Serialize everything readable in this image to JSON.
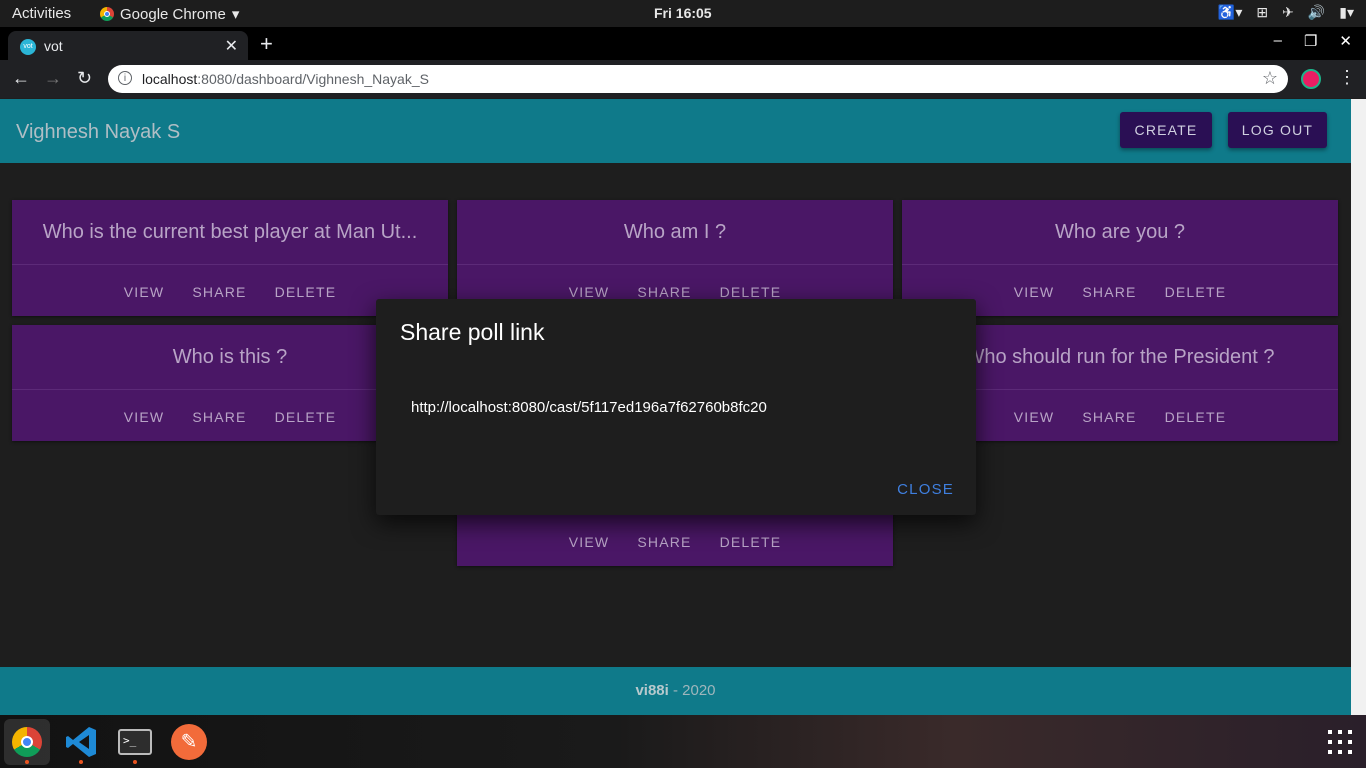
{
  "system_bar": {
    "activities": "Activities",
    "app_name": "Google Chrome",
    "clock": "Fri 16:05"
  },
  "browser": {
    "tab_title": "vot",
    "tab_favicon_text": "vot",
    "url_host": "localhost",
    "url_rest": ":8080/dashboard/Vighnesh_Nayak_S"
  },
  "header": {
    "user_name": "Vighnesh Nayak S",
    "create_label": "CREATE",
    "logout_label": "LOG OUT"
  },
  "polls": [
    {
      "question": "Who is the current best player at Man Ut...",
      "view": "VIEW",
      "share": "SHARE",
      "delete": "DELETE"
    },
    {
      "question": "Who am I ?",
      "view": "VIEW",
      "share": "SHARE",
      "delete": "DELETE"
    },
    {
      "question": "Who are you ?",
      "view": "VIEW",
      "share": "SHARE",
      "delete": "DELETE"
    },
    {
      "question": "Who is this ?",
      "view": "VIEW",
      "share": "SHARE",
      "delete": "DELETE"
    },
    {
      "question": "Who should run for the President ?",
      "view": "VIEW",
      "share": "SHARE",
      "delete": "DELETE"
    },
    {
      "question": "",
      "view": "VIEW",
      "share": "SHARE",
      "delete": "DELETE"
    }
  ],
  "dialog": {
    "title": "Share poll link",
    "link": "http://localhost:8080/cast/5f117ed196a7f62760b8fc20",
    "close_label": "CLOSE"
  },
  "footer": {
    "brand": "vi88i",
    "year": " - 2020"
  },
  "colors": {
    "header_bg": "#0f7a8a",
    "card_bg": "#4a1766",
    "button_bg": "#2a0f54",
    "accent_link": "#3f7fdf"
  }
}
